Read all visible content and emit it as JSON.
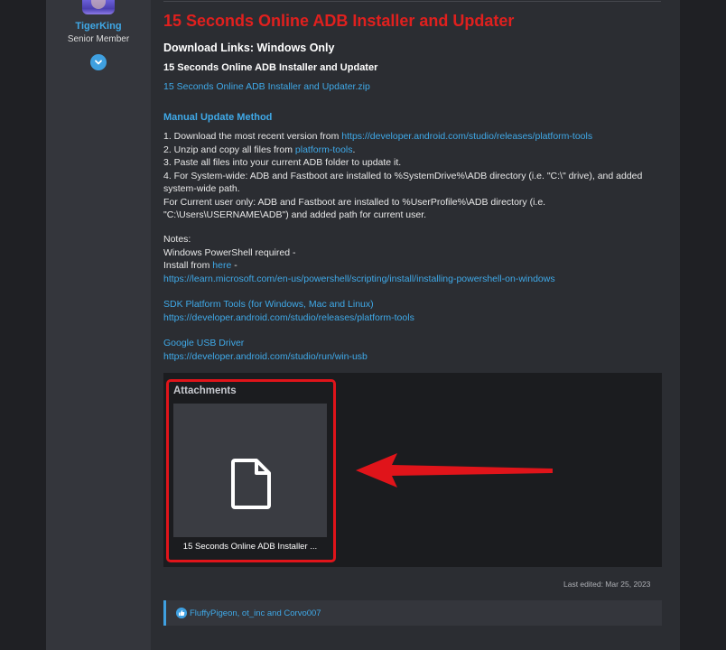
{
  "user": {
    "name": "TigerKing",
    "title": "Senior Member"
  },
  "post": {
    "title": "15 Seconds Online ADB Installer and Updater",
    "download_heading": "Download Links: Windows Only",
    "download_subheading": "15 Seconds Online ADB Installer and Updater",
    "zip_link": "15 Seconds Online ADB Installer and Updater.zip",
    "manual_heading": "Manual Update Method",
    "steps": {
      "s1_prefix": "1. Download the most recent version from ",
      "s1_link": "https://developer.android.com/studio/releases/platform-tools",
      "s2_prefix": "2. Unzip and copy all files from ",
      "s2_link": "platform-tools",
      "s2_suffix": ".",
      "s3": "3. Paste all files into your current ADB folder to update it.",
      "s4": "4. For System-wide: ADB and Fastboot are installed to %SystemDrive%\\ADB directory (i.e. \"C:\\\" drive), and added system-wide path.",
      "s5": "For Current user only: ADB and Fastboot are installed to %UserProfile%\\ADB directory (i.e. \"C:\\Users\\USERNAME\\ADB\") and added path for current user."
    },
    "notes": {
      "label": "Notes:",
      "powershell": "Windows PowerShell required -",
      "install_prefix": "Install from ",
      "install_link": "here",
      "install_suffix": " -",
      "ps_url": "https://learn.microsoft.com/en-us/powershell/scripting/install/installing-powershell-on-windows"
    },
    "sdk": {
      "label": "SDK Platform Tools (for Windows, Mac and Linux)",
      "url": "https://developer.android.com/studio/releases/platform-tools"
    },
    "usb": {
      "label": "Google USB Driver",
      "url": "https://developer.android.com/studio/run/win-usb"
    },
    "attachments": {
      "label": "Attachments",
      "file_name": "15 Seconds Online ADB Installer ..."
    },
    "last_edited": "Last edited: Mar 25, 2023",
    "reactions": "FluffyPigeon, ot_inc and Corvo007"
  },
  "colors": {
    "title_red": "#e0201e",
    "link_blue": "#3fa9e8",
    "highlight_red": "#e0141a"
  }
}
